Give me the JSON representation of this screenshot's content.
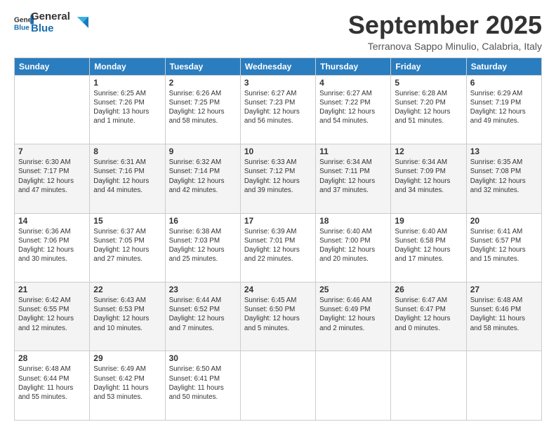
{
  "header": {
    "logo_general": "General",
    "logo_blue": "Blue",
    "month_title": "September 2025",
    "subtitle": "Terranova Sappo Minulio, Calabria, Italy"
  },
  "weekdays": [
    "Sunday",
    "Monday",
    "Tuesday",
    "Wednesday",
    "Thursday",
    "Friday",
    "Saturday"
  ],
  "weeks": [
    [
      {
        "day": "",
        "sunrise": "",
        "sunset": "",
        "daylight": ""
      },
      {
        "day": "1",
        "sunrise": "Sunrise: 6:25 AM",
        "sunset": "Sunset: 7:26 PM",
        "daylight": "Daylight: 13 hours and 1 minute."
      },
      {
        "day": "2",
        "sunrise": "Sunrise: 6:26 AM",
        "sunset": "Sunset: 7:25 PM",
        "daylight": "Daylight: 12 hours and 58 minutes."
      },
      {
        "day": "3",
        "sunrise": "Sunrise: 6:27 AM",
        "sunset": "Sunset: 7:23 PM",
        "daylight": "Daylight: 12 hours and 56 minutes."
      },
      {
        "day": "4",
        "sunrise": "Sunrise: 6:27 AM",
        "sunset": "Sunset: 7:22 PM",
        "daylight": "Daylight: 12 hours and 54 minutes."
      },
      {
        "day": "5",
        "sunrise": "Sunrise: 6:28 AM",
        "sunset": "Sunset: 7:20 PM",
        "daylight": "Daylight: 12 hours and 51 minutes."
      },
      {
        "day": "6",
        "sunrise": "Sunrise: 6:29 AM",
        "sunset": "Sunset: 7:19 PM",
        "daylight": "Daylight: 12 hours and 49 minutes."
      }
    ],
    [
      {
        "day": "7",
        "sunrise": "Sunrise: 6:30 AM",
        "sunset": "Sunset: 7:17 PM",
        "daylight": "Daylight: 12 hours and 47 minutes."
      },
      {
        "day": "8",
        "sunrise": "Sunrise: 6:31 AM",
        "sunset": "Sunset: 7:16 PM",
        "daylight": "Daylight: 12 hours and 44 minutes."
      },
      {
        "day": "9",
        "sunrise": "Sunrise: 6:32 AM",
        "sunset": "Sunset: 7:14 PM",
        "daylight": "Daylight: 12 hours and 42 minutes."
      },
      {
        "day": "10",
        "sunrise": "Sunrise: 6:33 AM",
        "sunset": "Sunset: 7:12 PM",
        "daylight": "Daylight: 12 hours and 39 minutes."
      },
      {
        "day": "11",
        "sunrise": "Sunrise: 6:34 AM",
        "sunset": "Sunset: 7:11 PM",
        "daylight": "Daylight: 12 hours and 37 minutes."
      },
      {
        "day": "12",
        "sunrise": "Sunrise: 6:34 AM",
        "sunset": "Sunset: 7:09 PM",
        "daylight": "Daylight: 12 hours and 34 minutes."
      },
      {
        "day": "13",
        "sunrise": "Sunrise: 6:35 AM",
        "sunset": "Sunset: 7:08 PM",
        "daylight": "Daylight: 12 hours and 32 minutes."
      }
    ],
    [
      {
        "day": "14",
        "sunrise": "Sunrise: 6:36 AM",
        "sunset": "Sunset: 7:06 PM",
        "daylight": "Daylight: 12 hours and 30 minutes."
      },
      {
        "day": "15",
        "sunrise": "Sunrise: 6:37 AM",
        "sunset": "Sunset: 7:05 PM",
        "daylight": "Daylight: 12 hours and 27 minutes."
      },
      {
        "day": "16",
        "sunrise": "Sunrise: 6:38 AM",
        "sunset": "Sunset: 7:03 PM",
        "daylight": "Daylight: 12 hours and 25 minutes."
      },
      {
        "day": "17",
        "sunrise": "Sunrise: 6:39 AM",
        "sunset": "Sunset: 7:01 PM",
        "daylight": "Daylight: 12 hours and 22 minutes."
      },
      {
        "day": "18",
        "sunrise": "Sunrise: 6:40 AM",
        "sunset": "Sunset: 7:00 PM",
        "daylight": "Daylight: 12 hours and 20 minutes."
      },
      {
        "day": "19",
        "sunrise": "Sunrise: 6:40 AM",
        "sunset": "Sunset: 6:58 PM",
        "daylight": "Daylight: 12 hours and 17 minutes."
      },
      {
        "day": "20",
        "sunrise": "Sunrise: 6:41 AM",
        "sunset": "Sunset: 6:57 PM",
        "daylight": "Daylight: 12 hours and 15 minutes."
      }
    ],
    [
      {
        "day": "21",
        "sunrise": "Sunrise: 6:42 AM",
        "sunset": "Sunset: 6:55 PM",
        "daylight": "Daylight: 12 hours and 12 minutes."
      },
      {
        "day": "22",
        "sunrise": "Sunrise: 6:43 AM",
        "sunset": "Sunset: 6:53 PM",
        "daylight": "Daylight: 12 hours and 10 minutes."
      },
      {
        "day": "23",
        "sunrise": "Sunrise: 6:44 AM",
        "sunset": "Sunset: 6:52 PM",
        "daylight": "Daylight: 12 hours and 7 minutes."
      },
      {
        "day": "24",
        "sunrise": "Sunrise: 6:45 AM",
        "sunset": "Sunset: 6:50 PM",
        "daylight": "Daylight: 12 hours and 5 minutes."
      },
      {
        "day": "25",
        "sunrise": "Sunrise: 6:46 AM",
        "sunset": "Sunset: 6:49 PM",
        "daylight": "Daylight: 12 hours and 2 minutes."
      },
      {
        "day": "26",
        "sunrise": "Sunrise: 6:47 AM",
        "sunset": "Sunset: 6:47 PM",
        "daylight": "Daylight: 12 hours and 0 minutes."
      },
      {
        "day": "27",
        "sunrise": "Sunrise: 6:48 AM",
        "sunset": "Sunset: 6:46 PM",
        "daylight": "Daylight: 11 hours and 58 minutes."
      }
    ],
    [
      {
        "day": "28",
        "sunrise": "Sunrise: 6:48 AM",
        "sunset": "Sunset: 6:44 PM",
        "daylight": "Daylight: 11 hours and 55 minutes."
      },
      {
        "day": "29",
        "sunrise": "Sunrise: 6:49 AM",
        "sunset": "Sunset: 6:42 PM",
        "daylight": "Daylight: 11 hours and 53 minutes."
      },
      {
        "day": "30",
        "sunrise": "Sunrise: 6:50 AM",
        "sunset": "Sunset: 6:41 PM",
        "daylight": "Daylight: 11 hours and 50 minutes."
      },
      {
        "day": "",
        "sunrise": "",
        "sunset": "",
        "daylight": ""
      },
      {
        "day": "",
        "sunrise": "",
        "sunset": "",
        "daylight": ""
      },
      {
        "day": "",
        "sunrise": "",
        "sunset": "",
        "daylight": ""
      },
      {
        "day": "",
        "sunrise": "",
        "sunset": "",
        "daylight": ""
      }
    ]
  ]
}
